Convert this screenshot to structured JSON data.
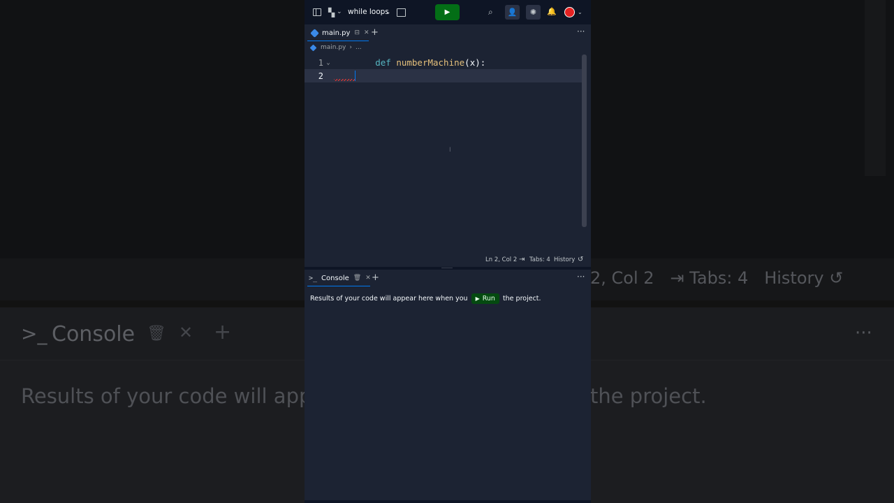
{
  "background": {
    "line_info": "2, Col 2",
    "tab_info": "Tabs: 4",
    "history": "History",
    "console_label": "Console",
    "console_prompt": ">_",
    "results_left": "Results of your code will appe",
    "results_right": "the project."
  },
  "topbar": {
    "project_name": "while loops",
    "run_icon": "play-icon",
    "avatar_color": "#e52222"
  },
  "editor_tab": {
    "label": "main.py"
  },
  "breadcrumb": {
    "file": "main.py",
    "separator": "›",
    "more": "..."
  },
  "editor": {
    "lines": [
      {
        "number": "1",
        "keyword": "def",
        "name": "numberMachine",
        "rest": "(x):"
      },
      {
        "number": "2",
        "text": ""
      }
    ]
  },
  "statusbar": {
    "position": "Ln 2, Col 2",
    "tabs": "Tabs: 4",
    "history": "History"
  },
  "console": {
    "tab_label": "Console",
    "prompt": ">_",
    "message_before": "Results of your code will appear here when you",
    "run_label": "Run",
    "message_after": "the project."
  },
  "colors": {
    "accent": "#0079f2",
    "run_green": "#036e16",
    "editor_bg": "#1c2333",
    "topbar_bg": "#0e1525"
  }
}
